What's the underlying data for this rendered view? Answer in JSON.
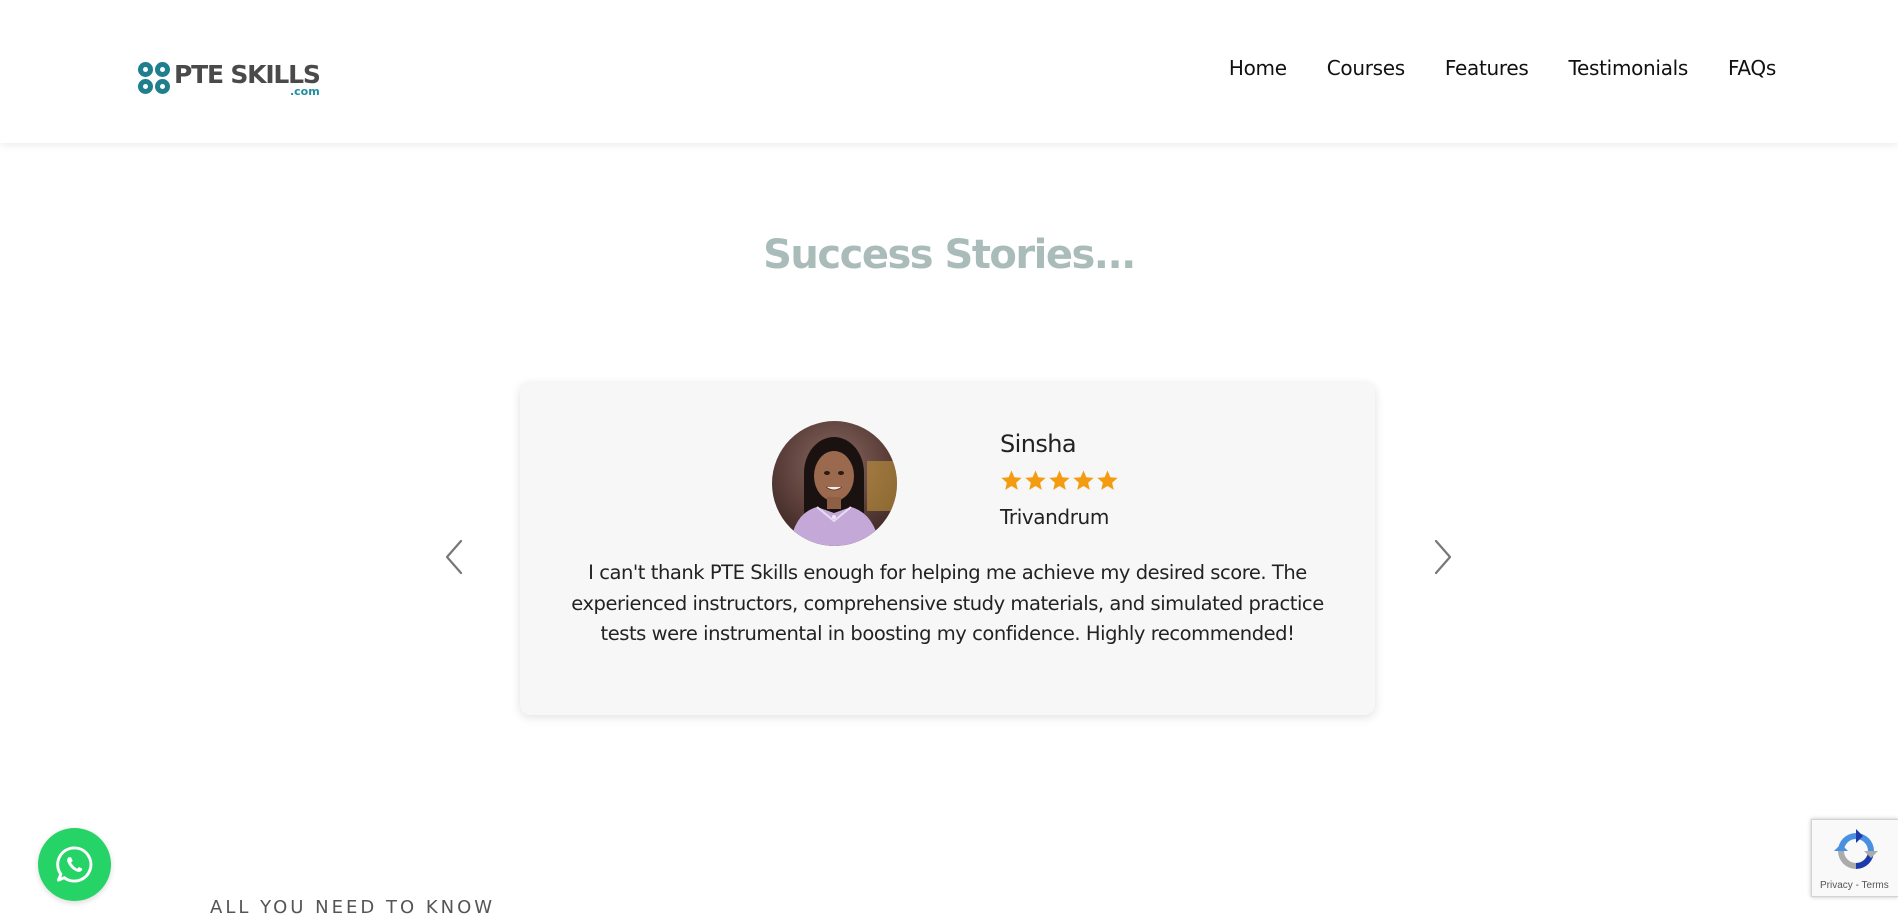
{
  "header": {
    "logo": {
      "text": "PTE SKILLS",
      "suffix": ".com",
      "brand_color": "#1f7f8e"
    },
    "nav": [
      {
        "label": "Home"
      },
      {
        "label": "Courses"
      },
      {
        "label": "Features"
      },
      {
        "label": "Testimonials"
      },
      {
        "label": "FAQs"
      }
    ]
  },
  "section": {
    "title": "Success Stories...",
    "title_color": "#a9bcb9"
  },
  "testimonial": {
    "name": "Sinsha",
    "rating": 5,
    "rating_max": 5,
    "star_color": "#f39c12",
    "city": "Trivandrum",
    "text": "I can't thank PTE Skills enough for helping me achieve my desired score. The experienced instructors, comprehensive study materials, and simulated practice tests were instrumental in boosting my confidence. Highly recommended!"
  },
  "carousel": {
    "prev_icon": "chevron-left-icon",
    "next_icon": "chevron-right-icon"
  },
  "next_section": {
    "heading": "ALL YOU NEED TO KNOW"
  },
  "whatsapp": {
    "icon": "whatsapp-icon",
    "color": "#25d366"
  },
  "recaptcha": {
    "privacy": "Privacy",
    "separator": " - ",
    "terms": "Terms"
  }
}
